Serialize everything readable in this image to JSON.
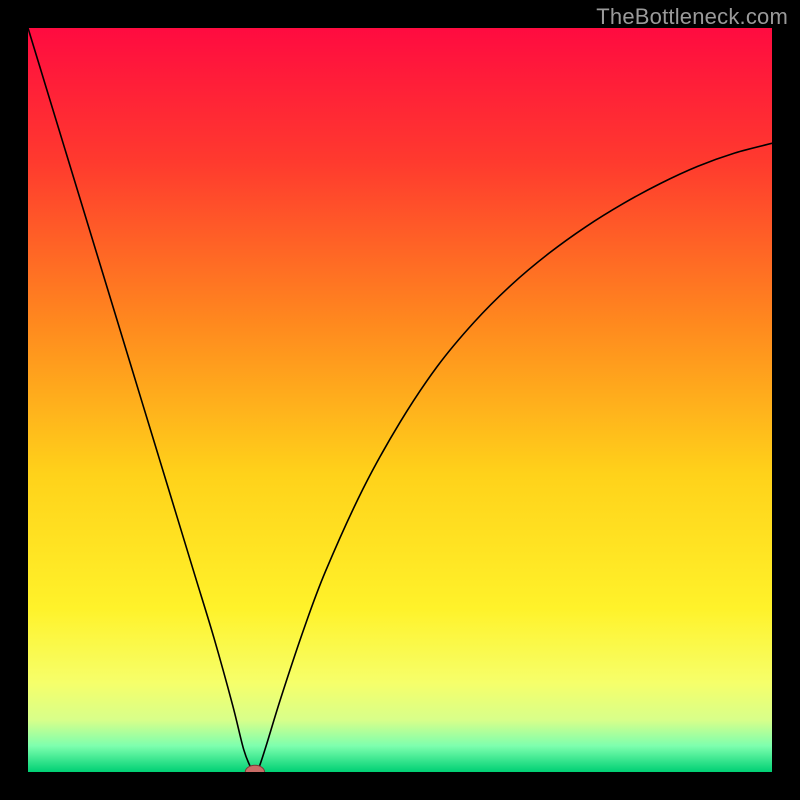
{
  "watermark": {
    "text": "TheBottleneck.com"
  },
  "chart_data": {
    "type": "line",
    "title": "",
    "xlabel": "",
    "ylabel": "",
    "xlim": [
      0,
      100
    ],
    "ylim": [
      0,
      100
    ],
    "grid": false,
    "legend": false,
    "background": {
      "type": "vertical-gradient",
      "stops": [
        {
          "offset": 0.0,
          "color": "#ff0b40"
        },
        {
          "offset": 0.18,
          "color": "#ff3a2e"
        },
        {
          "offset": 0.4,
          "color": "#ff8a1e"
        },
        {
          "offset": 0.6,
          "color": "#ffd21a"
        },
        {
          "offset": 0.78,
          "color": "#fff22a"
        },
        {
          "offset": 0.88,
          "color": "#f6ff6a"
        },
        {
          "offset": 0.93,
          "color": "#d8ff8a"
        },
        {
          "offset": 0.965,
          "color": "#7dffae"
        },
        {
          "offset": 1.0,
          "color": "#00d074"
        }
      ]
    },
    "series": [
      {
        "name": "bottleneck-curve",
        "color": "#000000",
        "stroke_width": 1.6,
        "x": [
          0.0,
          2.5,
          5.0,
          7.5,
          10.0,
          12.5,
          15.0,
          17.5,
          20.0,
          22.5,
          25.0,
          27.5,
          29.0,
          30.0,
          30.5,
          31.0,
          32.0,
          34.0,
          37.0,
          40.0,
          45.0,
          50.0,
          55.0,
          60.0,
          65.0,
          70.0,
          75.0,
          80.0,
          85.0,
          90.0,
          95.0,
          100.0
        ],
        "y": [
          100.0,
          91.8,
          83.6,
          75.4,
          67.2,
          59.0,
          50.8,
          42.6,
          34.4,
          26.2,
          18.0,
          9.0,
          3.0,
          0.5,
          0.0,
          0.5,
          3.5,
          10.0,
          19.0,
          27.0,
          38.0,
          47.0,
          54.5,
          60.5,
          65.5,
          69.7,
          73.3,
          76.4,
          79.1,
          81.4,
          83.2,
          84.5
        ]
      }
    ],
    "marker": {
      "name": "optimum-point",
      "x": 30.5,
      "y": 0.0,
      "rx": 1.3,
      "ry": 0.9,
      "fill": "#c86c66",
      "stroke": "#7a3a38"
    }
  }
}
